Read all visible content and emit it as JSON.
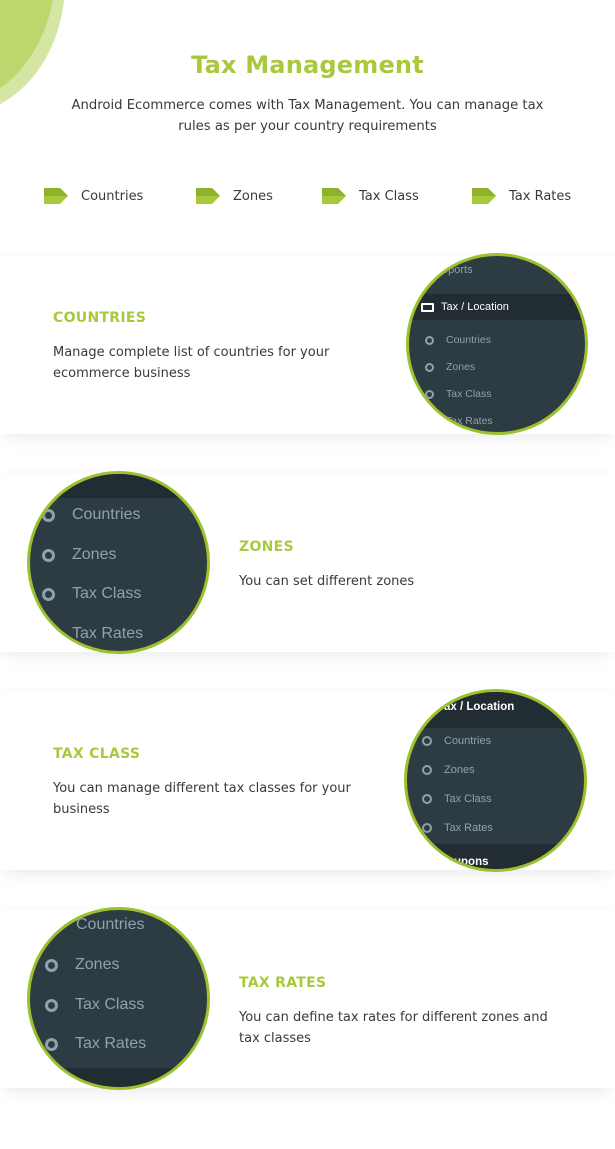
{
  "header": {
    "title": "Tax Management",
    "subtitle": "Android Ecommerce comes with Tax Management. You can manage tax rules as per your country requirements"
  },
  "features": [
    {
      "label": "Countries",
      "icon": "tag-arrow-icon"
    },
    {
      "label": "Zones",
      "icon": "tag-arrow-icon"
    },
    {
      "label": "Tax Class",
      "icon": "tag-arrow-icon"
    },
    {
      "label": "Tax Rates",
      "icon": "tag-arrow-icon"
    }
  ],
  "sections": [
    {
      "heading": "COUNTRIES",
      "description": "Manage complete list of countries for your ecommerce business",
      "zoom_menu": {
        "top_partial": "eports",
        "parent": "Tax / Location",
        "items": [
          "Countries",
          "Zones",
          "Tax Class",
          "Tax Rates"
        ]
      }
    },
    {
      "heading": "ZONES",
      "description": "You can set different zones",
      "zoom_menu": {
        "items": [
          "Countries",
          "Zones",
          "Tax Class",
          "Tax Rates"
        ]
      }
    },
    {
      "heading": "TAX CLASS",
      "description": "You can manage different tax classes for your business",
      "zoom_menu": {
        "parent": "ax / Location",
        "items": [
          "Countries",
          "Zones",
          "Tax Class",
          "Tax Rates"
        ],
        "bottom_partial": "upons"
      }
    },
    {
      "heading": "TAX RATES",
      "description": "You can define tax rates for different zones and tax classes",
      "zoom_menu": {
        "items": [
          "Countries",
          "Zones",
          "Tax Class",
          "Tax Rates"
        ]
      }
    }
  ],
  "colors": {
    "accent": "#a8c93c",
    "circle_border": "#9cc12d",
    "menu_bg": "#2d3b43",
    "menu_dark": "#222d33",
    "menu_text": "#8fa3ad"
  }
}
